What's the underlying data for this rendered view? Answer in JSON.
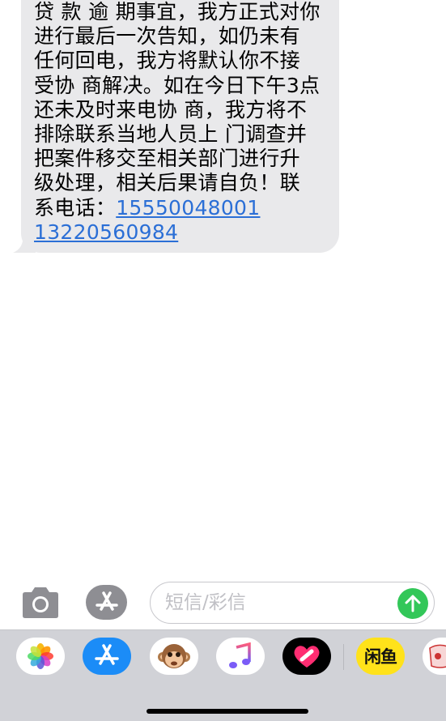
{
  "message": {
    "lines": [
      "贷 款 逾 期事宜，我方正式对你",
      "进行最后一次告知，如仍未有",
      "任何回电，我方将默认你不接",
      "受协 商解决。如在今日下午3点",
      "还未及时来电协 商，我方将不",
      "排除联系当地人员上 门调查并",
      "把案件移交至相关部门进行升",
      "级处理，相关后果请自负！联"
    ],
    "contact_prefix": "系电话：",
    "phone1": "15550048001",
    "phone2": "13220560984"
  },
  "compose": {
    "placeholder": "短信/彩信"
  },
  "drawer": {
    "xianyu_label": "闲鱼"
  },
  "colors": {
    "bubble": "#e9e9eb",
    "link": "#2b6fd6",
    "send": "#33c759",
    "drawer": "#d1d2d7"
  },
  "icons": [
    "camera-icon",
    "app-store-icon",
    "send-arrow-icon",
    "photos-icon",
    "animoji-icon",
    "music-icon",
    "heart-app-icon",
    "xianyu-icon",
    "sticker-icon"
  ]
}
